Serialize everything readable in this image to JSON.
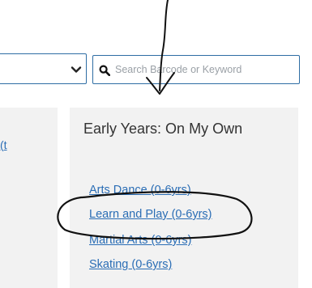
{
  "search": {
    "placeholder": "Search Barcode or Keyword"
  },
  "category_select": {
    "selected_value": ""
  },
  "left_panel": {
    "cut_link_text": "t)"
  },
  "right_panel": {
    "heading": "Early Years: On My Own",
    "links": [
      {
        "label": "Arts Dance (0-6yrs)"
      },
      {
        "label": "Learn and Play (0-6yrs)"
      },
      {
        "label": "Martial Arts (0-6yrs)"
      },
      {
        "label": "Skating (0-6yrs)"
      }
    ]
  },
  "colors": {
    "link": "#2a6db5",
    "input_border": "#2e6da4",
    "panel_background": "#f2f2f2",
    "annotation_ink": "#111111"
  },
  "icons": {
    "search": "search-icon",
    "dropdown": "chevron-down-icon"
  }
}
